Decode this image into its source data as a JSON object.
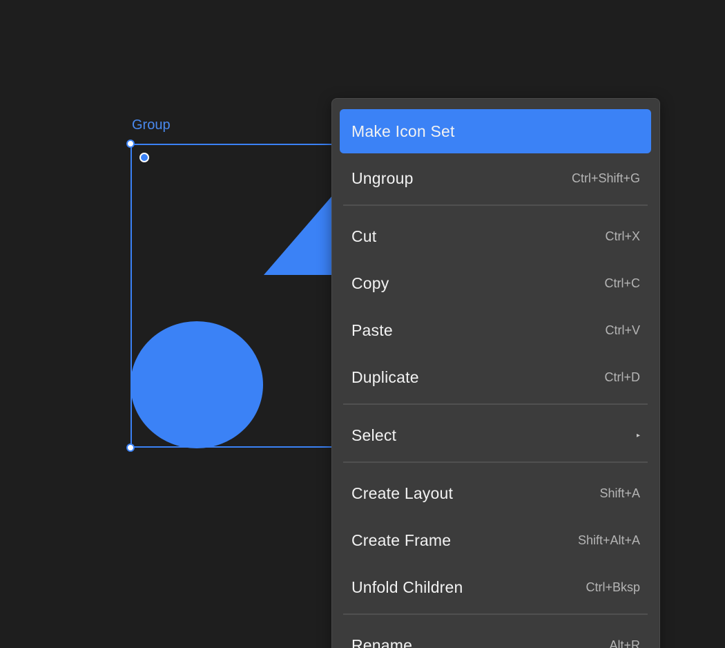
{
  "canvas": {
    "group_label": "Group"
  },
  "context_menu": {
    "items": [
      {
        "label": "Make Icon Set",
        "shortcut": ""
      },
      {
        "label": "Ungroup",
        "shortcut": "Ctrl+Shift+G"
      },
      {
        "label": "Cut",
        "shortcut": "Ctrl+X"
      },
      {
        "label": "Copy",
        "shortcut": "Ctrl+C"
      },
      {
        "label": "Paste",
        "shortcut": "Ctrl+V"
      },
      {
        "label": "Duplicate",
        "shortcut": "Ctrl+D"
      },
      {
        "label": "Select",
        "submenu_icon": "chevron-right-icon"
      },
      {
        "label": "Create Layout",
        "shortcut": "Shift+A"
      },
      {
        "label": "Create Frame",
        "shortcut": "Shift+Alt+A"
      },
      {
        "label": "Unfold Children",
        "shortcut": "Ctrl+Bksp"
      },
      {
        "label": "Rename",
        "shortcut": "Alt+R"
      }
    ]
  },
  "colors": {
    "background": "#1e1e1e",
    "accent": "#3b82f6",
    "menu_background": "#3c3c3c",
    "menu_text": "#f2f2f2",
    "shortcut_text": "#b5b5b5"
  }
}
